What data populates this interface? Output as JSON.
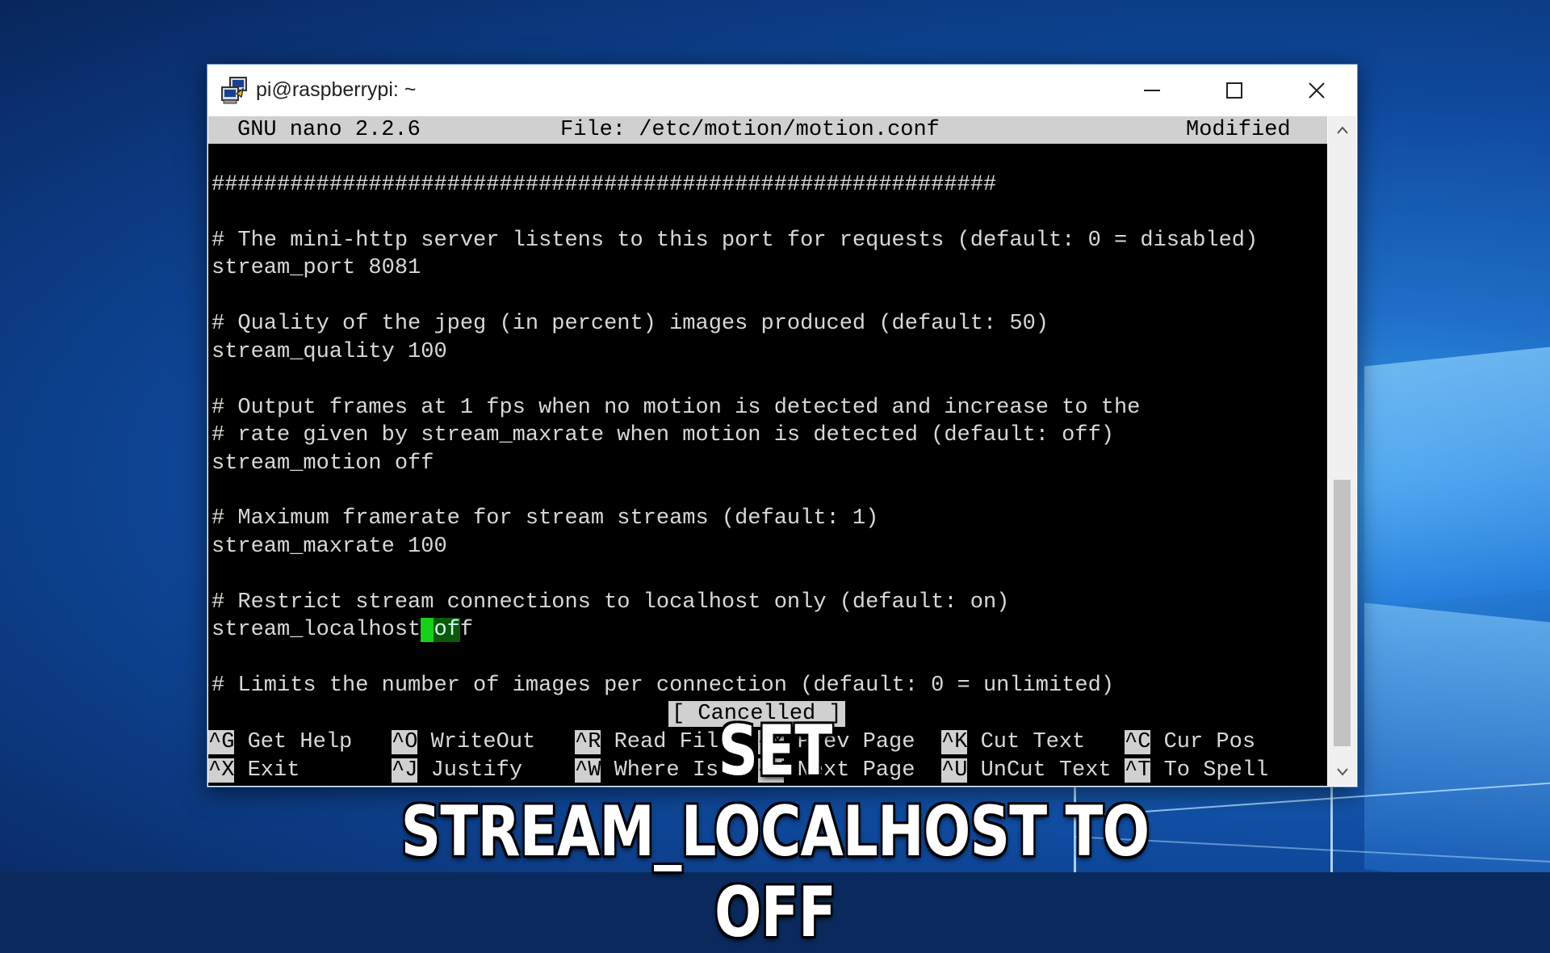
{
  "window": {
    "title": "pi@raspberrypi: ~",
    "icons": {
      "app": "putty-icon",
      "minimize": "minimize-icon",
      "maximize": "maximize-icon",
      "close": "close-icon"
    }
  },
  "nano": {
    "version": "GNU nano 2.2.6",
    "file": "File: /etc/motion/motion.conf",
    "state": "Modified",
    "lines": [
      "############################################################",
      "",
      "# The mini-http server listens to this port for requests (default: 0 = disabled)",
      "stream_port 8081",
      "",
      "# Quality of the jpeg (in percent) images produced (default: 50)",
      "stream_quality 100",
      "",
      "# Output frames at 1 fps when no motion is detected and increase to the",
      "# rate given by stream_maxrate when motion is detected (default: off)",
      "stream_motion off",
      "",
      "# Maximum framerate for stream streams (default: 1)",
      "stream_maxrate 100",
      "",
      "# Restrict stream connections to localhost only (default: on)",
      "stream_localhost",
      "",
      "# Limits the number of images per connection (default: 0 = unlimited)"
    ],
    "cursor_char": " ",
    "highlight_text": "of",
    "after_highlight": "f",
    "status_message": "[ Cancelled ]",
    "shortcuts_row1": [
      {
        "key": "^G",
        "label": "Get Help"
      },
      {
        "key": "^O",
        "label": "WriteOut"
      },
      {
        "key": "^R",
        "label": "Read File"
      },
      {
        "key": "^Y",
        "label": "Prev Page"
      },
      {
        "key": "^K",
        "label": "Cut Text"
      },
      {
        "key": "^C",
        "label": "Cur Pos"
      }
    ],
    "shortcuts_row2": [
      {
        "key": "^X",
        "label": "Exit"
      },
      {
        "key": "^J",
        "label": "Justify"
      },
      {
        "key": "^W",
        "label": "Where Is"
      },
      {
        "key": "^V",
        "label": "Next Page"
      },
      {
        "key": "^U",
        "label": "UnCut Text"
      },
      {
        "key": "^T",
        "label": "To Spell"
      }
    ]
  },
  "caption": "SET STREAM_LOCALHOST TO OFF",
  "colors": {
    "cursor": "#18d018",
    "terminal_bg": "#000000",
    "header_bg": "#d0d0d0"
  }
}
